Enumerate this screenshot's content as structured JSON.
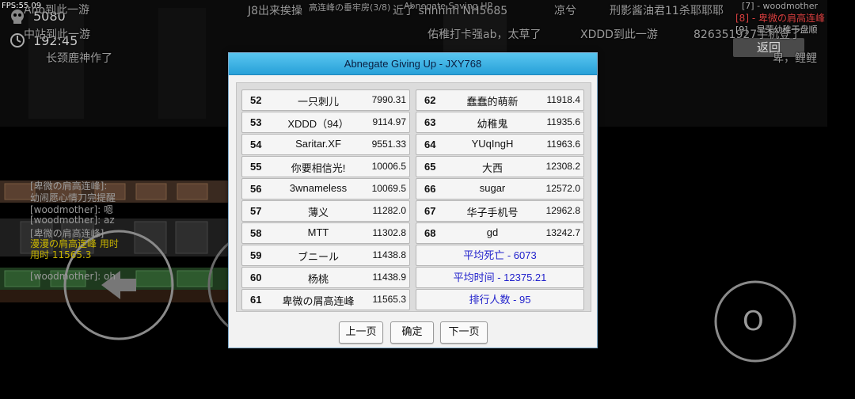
{
  "hud": {
    "fps": "FPS:55.09",
    "deaths": "5080",
    "timer": "192:45",
    "back_button": "返回"
  },
  "danmaku": [
    "Ano到此一游",
    "J8出来挨操",
    "高连峰の垂牢房(3/8)",
    "Abnegate Saving HP",
    "近了 shhhhh NH5685",
    "凉兮",
    "刑影酱油君11杀耶耶耶",
    "中站到此一游",
    "佑稚打卡强ab，太草了",
    "XDDD到此一游",
    "826351927手机登了",
    "长颈鹿神作了",
    "卑，鲤鲤"
  ],
  "side_messages": {
    "msg1": "[7] - woodmother",
    "msg2": "[8] - 卑微の肩高连峰",
    "msg3": "[9] - 早荣幼稚于盘顺"
  },
  "chat_log": [
    "[卑微の肩高连峰]:",
    "幼闹愿心情刀完提醒",
    "[woodmother]: 嗯",
    "[woodmother]: az",
    "[卑微の肩高连峰]",
    "漫漫の肩高连峰 用时",
    "用时 11565.3",
    "[woodmother]: oh"
  ],
  "dialog": {
    "title": "Abnegate Giving Up - JXY768",
    "left_entries": [
      {
        "rank": "52",
        "name": "一只刺儿",
        "time": "7990.31"
      },
      {
        "rank": "53",
        "name": "XDDD（94）",
        "time": "9114.97"
      },
      {
        "rank": "54",
        "name": "Saritar.XF",
        "time": "9551.33"
      },
      {
        "rank": "55",
        "name": "你要相信光!",
        "time": "10006.5"
      },
      {
        "rank": "56",
        "name": "3wnameless",
        "time": "10069.5"
      },
      {
        "rank": "57",
        "name": "薄义",
        "time": "11282.0"
      },
      {
        "rank": "58",
        "name": "MTT",
        "time": "11302.8"
      },
      {
        "rank": "59",
        "name": "ブニール",
        "time": "11438.8"
      },
      {
        "rank": "60",
        "name": "杨桃",
        "time": "11438.9"
      },
      {
        "rank": "61",
        "name": "卑微の屑高连峰",
        "time": "11565.3"
      }
    ],
    "right_entries": [
      {
        "rank": "62",
        "name": "蠢蠢的萌新",
        "time": "11918.4"
      },
      {
        "rank": "63",
        "name": "幼稚鬼",
        "time": "11935.6"
      },
      {
        "rank": "64",
        "name": "YUqIngH",
        "time": "11963.6"
      },
      {
        "rank": "65",
        "name": "大西",
        "time": "12308.2"
      },
      {
        "rank": "66",
        "name": "sugar",
        "time": "12572.0"
      },
      {
        "rank": "67",
        "name": "华子手机号",
        "time": "12962.8"
      },
      {
        "rank": "68",
        "name": "gd",
        "time": "13242.7"
      }
    ],
    "stats": {
      "avg_deaths": "平均死亡 - 6073",
      "avg_time": "平均时间 - 12375.21",
      "ranked_count": "排行人数 - 95"
    },
    "buttons": {
      "prev": "上一页",
      "ok": "确定",
      "next": "下一页"
    }
  },
  "controls": {
    "jump_label": "O"
  },
  "colors": {
    "title_bar": "#27a0d8",
    "stat_text": "#2222cc",
    "danger_text": "#d94040"
  }
}
